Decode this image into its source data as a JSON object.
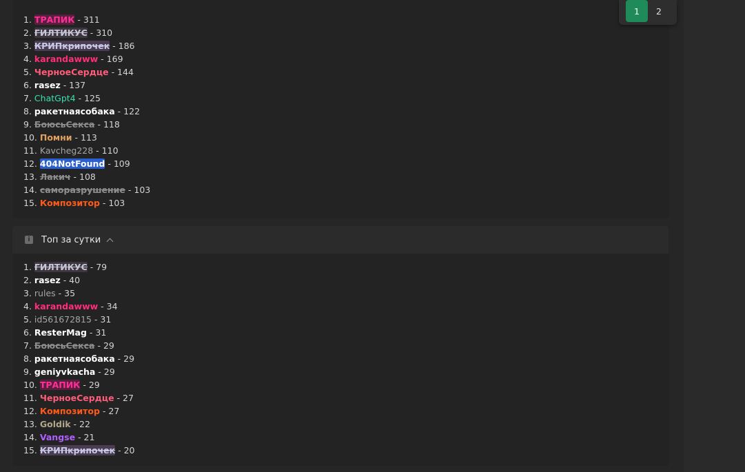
{
  "colors": {
    "accent": "#1f8a5a",
    "background": "#262626",
    "panel": "#232323"
  },
  "pagination": {
    "pages": [
      "1",
      "2"
    ],
    "active": "1"
  },
  "top_all": [
    {
      "rank": "1.",
      "name": "ТРАПИК",
      "score": " - 311",
      "color": "#ff2e9a",
      "strike": false,
      "bg": "#5a1f3c"
    },
    {
      "rank": "2.",
      "name": "ГИЛТИКУС",
      "score": " - 310",
      "color": "#c6c6d6",
      "strike": true,
      "bg": "#3d3540"
    },
    {
      "rank": "3.",
      "name": "КРИПкрипочек",
      "score": " - 186",
      "color": "#c9c9e8",
      "strike": true,
      "bg": "#4a3d52"
    },
    {
      "rank": "4.",
      "name": "karandawww",
      "score": " - 169",
      "color": "#ff2e7a",
      "strike": false
    },
    {
      "rank": "5.",
      "name": "ЧерноеСердце",
      "score": " - 144",
      "color": "#ff5c7a",
      "strike": false
    },
    {
      "rank": "6.",
      "name": "rasez",
      "score": " - 137",
      "color": "#ffffff",
      "strike": false
    },
    {
      "rank": "7.",
      "name": "ChatGpt4",
      "score": " - 125",
      "color": "#38e0b0",
      "strike": false,
      "light": true
    },
    {
      "rank": "8.",
      "name": "ракетнаясобака",
      "score": " - 122",
      "color": "#ffffff",
      "strike": false
    },
    {
      "rank": "9.",
      "name": "БоюсьСекса",
      "score": " - 118",
      "color": "#8e8e8e",
      "strike": true
    },
    {
      "rank": "10.",
      "name": "Помни",
      "score": " - 113",
      "color": "#e0a060",
      "strike": false
    },
    {
      "rank": "11.",
      "name": "Kavcheg228",
      "score": " - 110",
      "color": "#a6a6a6",
      "strike": false,
      "light": true
    },
    {
      "rank": "12.",
      "name": "404NotFound",
      "score": " - 109",
      "color": "#ffffff",
      "strike": false,
      "bg": "#2a5fd0"
    },
    {
      "rank": "13.",
      "name": "Лакич",
      "score": " - 108",
      "color": "#8e8e8e",
      "strike": true
    },
    {
      "rank": "14.",
      "name": "саморазрушение",
      "score": " - 103",
      "color": "#8e8e8e",
      "strike": true
    },
    {
      "rank": "15.",
      "name": "Композитор",
      "score": " - 103",
      "color": "#ff5a1a",
      "strike": false
    }
  ],
  "daily": {
    "title": "Топ за сутки",
    "rows": [
      {
        "rank": "1.",
        "name": "ГИЛТИКУС",
        "score": " - 79",
        "color": "#c6c6d6",
        "strike": true,
        "bg": "#3d3540"
      },
      {
        "rank": "2.",
        "name": "rasez",
        "score": " - 40",
        "color": "#ffffff",
        "strike": false
      },
      {
        "rank": "3.",
        "name": "rules",
        "score": " - 35",
        "color": "#a6a6a6",
        "strike": false,
        "light": true
      },
      {
        "rank": "4.",
        "name": "karandawww",
        "score": " - 34",
        "color": "#ff2e7a",
        "strike": false
      },
      {
        "rank": "5.",
        "name": "id561672815",
        "score": " - 31",
        "color": "#a6a6a6",
        "strike": false,
        "light": true
      },
      {
        "rank": "6.",
        "name": "ResterMag",
        "score": " - 31",
        "color": "#ffffff",
        "strike": false
      },
      {
        "rank": "7.",
        "name": "БоюсьСекса",
        "score": " - 29",
        "color": "#8e8e8e",
        "strike": true
      },
      {
        "rank": "8.",
        "name": "ракетнаясобака",
        "score": " - 29",
        "color": "#ffffff",
        "strike": false
      },
      {
        "rank": "9.",
        "name": "geniyvkacha",
        "score": " - 29",
        "color": "#ffffff",
        "strike": false
      },
      {
        "rank": "10.",
        "name": "ТРАПИК",
        "score": " - 29",
        "color": "#ff2e9a",
        "strike": false,
        "bg": "#5a1f3c"
      },
      {
        "rank": "11.",
        "name": "ЧерноеСердце",
        "score": " - 27",
        "color": "#ff5c7a",
        "strike": false
      },
      {
        "rank": "12.",
        "name": "Композитор",
        "score": " - 27",
        "color": "#ff5a1a",
        "strike": false
      },
      {
        "rank": "13.",
        "name": "Goldik",
        "score": " - 22",
        "color": "#b0a68a",
        "strike": false
      },
      {
        "rank": "14.",
        "name": "Vangse",
        "score": " - 21",
        "color": "#b060ff",
        "strike": false
      },
      {
        "rank": "15.",
        "name": "КРИПкрипочек",
        "score": " - 20",
        "color": "#c9c9e8",
        "strike": true,
        "bg": "#4a3d52"
      }
    ]
  }
}
